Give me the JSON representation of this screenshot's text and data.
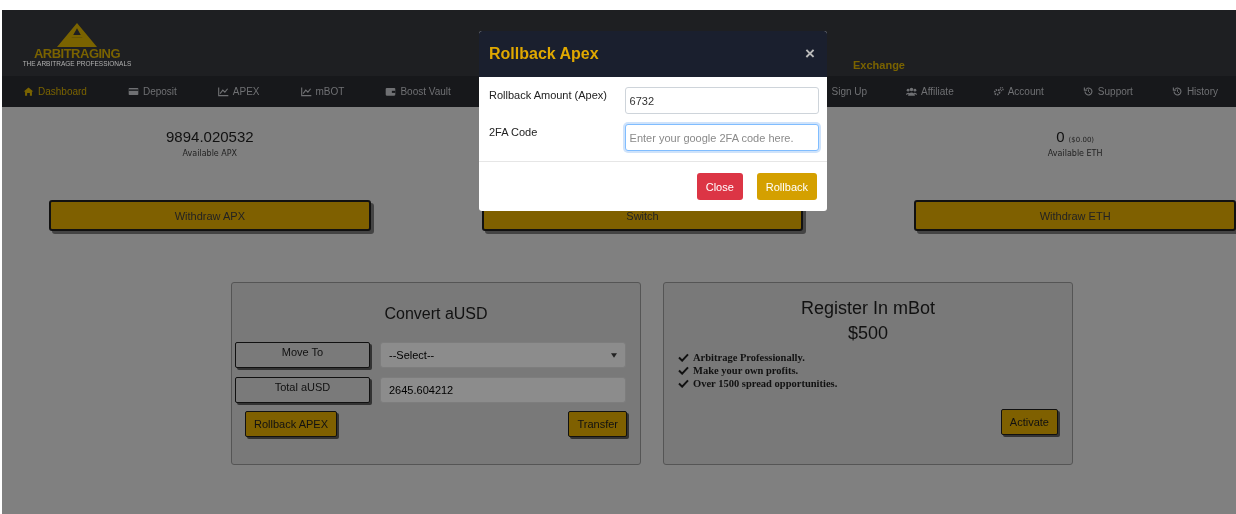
{
  "header": {
    "logo": {
      "name": "ARBITRAGING",
      "tagline": "THE ARBITRAGE PROFESSIONALS"
    },
    "exchange_link": "Exchange"
  },
  "nav": {
    "left": [
      {
        "label": "Dashboard",
        "selected": true
      },
      {
        "label": "Deposit",
        "selected": false
      },
      {
        "label": "APEX",
        "selected": false
      },
      {
        "label": "mBOT",
        "selected": false
      },
      {
        "label": "Boost Vault",
        "selected": false
      }
    ],
    "right": [
      {
        "label": "Sign Up",
        "selected": false
      },
      {
        "label": "Affiliate",
        "selected": false
      },
      {
        "label": "Account",
        "selected": false
      },
      {
        "label": "Support",
        "selected": false
      },
      {
        "label": "History",
        "selected": false
      }
    ]
  },
  "balances": [
    {
      "amount": "9894.020532",
      "caption": "Available APX",
      "button": "Withdraw APX"
    },
    {
      "button": "Switch"
    },
    {
      "amount": "0",
      "usd": "($0.00)",
      "caption": "Available ETH",
      "button": "Withdraw ETH"
    }
  ],
  "convert_card": {
    "title": "Convert aUSD",
    "rows": [
      {
        "kind": "select",
        "label": "Move To",
        "value": "--Select--"
      },
      {
        "kind": "input",
        "label": "Total aUSD",
        "value": "2645.604212"
      }
    ],
    "buttons": [
      "Rollback APEX",
      "Transfer"
    ]
  },
  "mbot_card": {
    "title": "Register In mBot",
    "price": "$500",
    "features": [
      "Arbitrage Professionally.",
      "Make your own profits.",
      "Over 1500 spread opportunities."
    ],
    "button": "Activate"
  },
  "modal": {
    "title": "Rollback Apex",
    "close": "×",
    "fields": [
      {
        "label": "Rollback Amount (Apex)",
        "value": "6732",
        "focused": false
      },
      {
        "label": "2FA Code",
        "placeholder": "Enter your google 2FA code here.",
        "focused": true
      }
    ],
    "buttons": [
      {
        "kind": "danger",
        "label": "Close"
      },
      {
        "kind": "primary",
        "label": "Rollback"
      }
    ]
  }
}
